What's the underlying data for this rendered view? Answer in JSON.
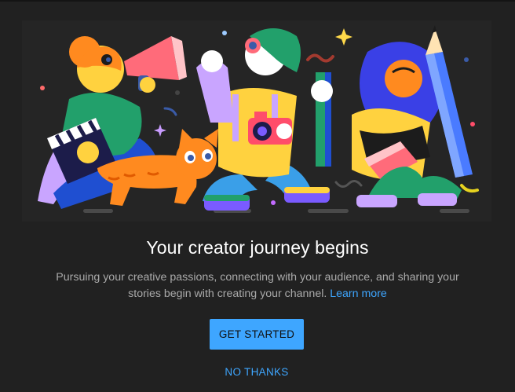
{
  "dialog": {
    "title": "Your creator journey begins",
    "body": "Pursuing your creative passions, connecting with your audience, and sharing your stories begin with creating your channel.",
    "learn_more": "Learn more",
    "primary_button": "GET STARTED",
    "secondary_button": "NO THANKS"
  },
  "colors": {
    "background": "#212121",
    "accent": "#3ea6ff",
    "title_text": "#ffffff",
    "body_text": "#aaaaaa"
  },
  "illustration": {
    "subject": "creator-characters-illustration",
    "elements": [
      "megaphone-person",
      "cat",
      "camera-person",
      "pencil-person",
      "clapperboard"
    ]
  }
}
